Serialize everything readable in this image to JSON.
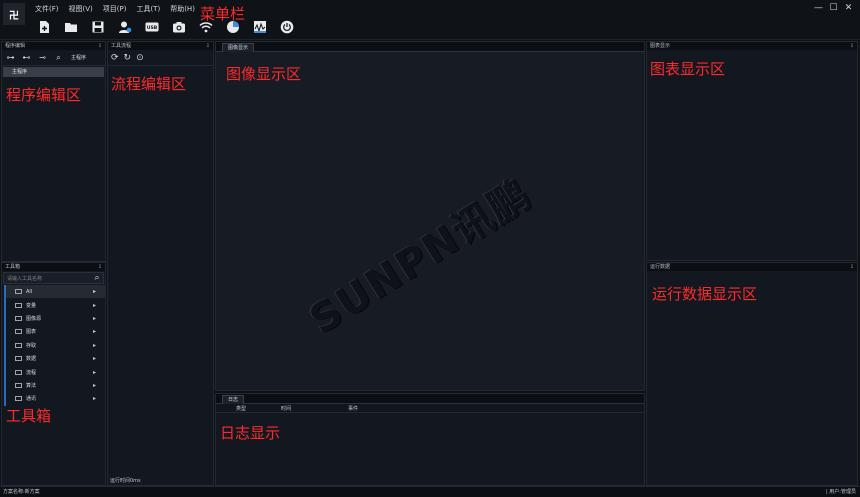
{
  "app": {
    "logo_glyph": "卍"
  },
  "menu": [
    "文件(F)",
    "视图(V)",
    "项目(P)",
    "工具(T)",
    "帮助(H)"
  ],
  "toolbar": {
    "icons": [
      "new-file-icon",
      "open-folder-icon",
      "save-icon",
      "user-icon",
      "usb-icon",
      "camera-icon",
      "wifi-icon",
      "pie-chart-icon",
      "waveform-icon",
      "power-icon"
    ],
    "usb_text": "USB"
  },
  "window": {
    "minimize": "—",
    "maximize": "☐",
    "close": "✕"
  },
  "panels": {
    "program_editor": {
      "title": "程序编辑",
      "main_program_button": "主程序",
      "tree_root": "主程序"
    },
    "tool_flow": {
      "title": "工具流程",
      "runtime": "运行时间0ms"
    },
    "image_display": {
      "tab": "图像显示"
    },
    "chart_display": {
      "title": "图表显示"
    },
    "run_data": {
      "title": "运行数据"
    },
    "log": {
      "tab": "日志",
      "col_type": "类型",
      "col_time": "时间",
      "col_event": "事件"
    },
    "toolbox": {
      "title": "工具箱",
      "search_placeholder": "请输入工具名称",
      "items": [
        "All",
        "变量",
        "图像源",
        "图表",
        "存取",
        "数据",
        "流程",
        "算法",
        "通讯"
      ]
    }
  },
  "annotations": {
    "menu_bar": "菜单栏",
    "program_area": "程序编辑区",
    "flow_area": "流程编辑区",
    "image_area": "图像显示区",
    "chart_area": "图表显示区",
    "run_data_area": "运行数据显示区",
    "toolbox": "工具箱",
    "log_area": "日志显示"
  },
  "watermark": "SUNPN讯鹏",
  "status": {
    "scheme": "方案名称:新方案",
    "user": "| 用户:管理员"
  },
  "pin_glyph": "⇩"
}
